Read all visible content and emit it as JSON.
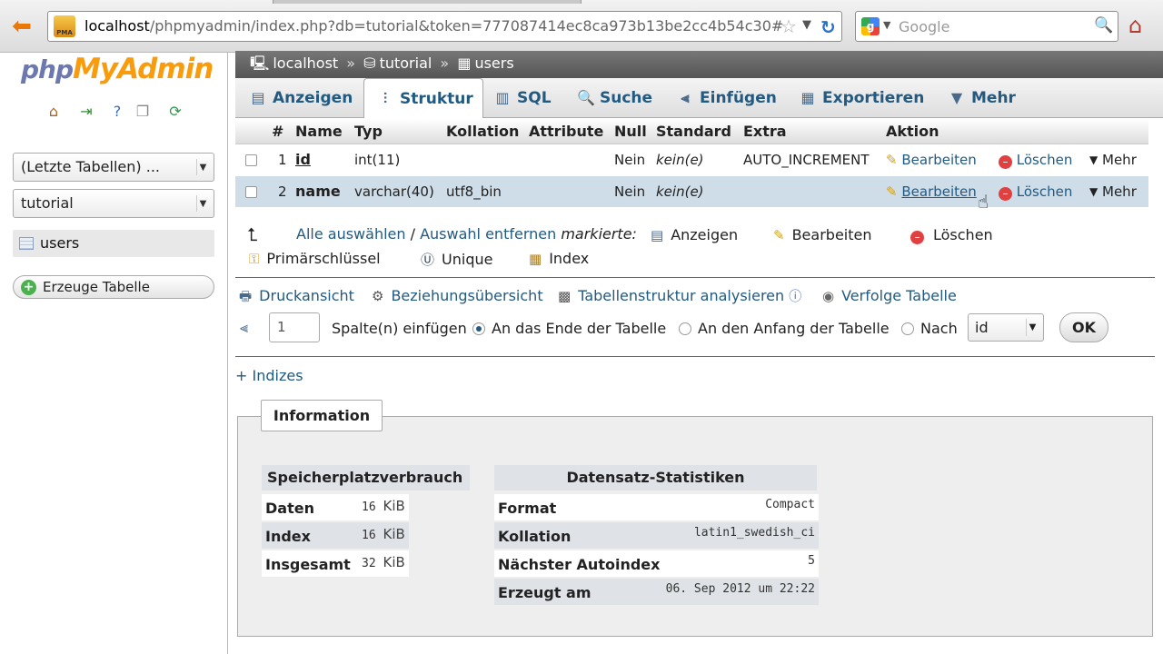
{
  "browser": {
    "url_host": "localhost",
    "url_rest": "/phpmyadmin/index.php?db=tutorial&token=777087414ec8ca973b13be2cc4b54c30#",
    "search_placeholder": "Google",
    "pma_icon_text": "PMA"
  },
  "sidebar": {
    "logo_php": "php",
    "logo_myadmin": "MyAdmin",
    "recent_tables": "(Letzte Tabellen) ...",
    "database": "tutorial",
    "table_item": "users",
    "create_table": "Erzeuge Tabelle"
  },
  "breadcrumb": {
    "server": "localhost",
    "sep1": "»",
    "database": "tutorial",
    "sep2": "»",
    "table": "users"
  },
  "tabs": [
    {
      "label": "Anzeigen",
      "icon": "browse-icon"
    },
    {
      "label": "Struktur",
      "icon": "structure-icon"
    },
    {
      "label": "SQL",
      "icon": "sql-icon"
    },
    {
      "label": "Suche",
      "icon": "search-icon"
    },
    {
      "label": "Einfügen",
      "icon": "insert-icon"
    },
    {
      "label": "Exportieren",
      "icon": "export-icon"
    },
    {
      "label": "Mehr",
      "icon": "chevron-down-icon"
    }
  ],
  "structure": {
    "headers": {
      "num": "#",
      "name": "Name",
      "type": "Typ",
      "collation": "Kollation",
      "attributes": "Attribute",
      "null": "Null",
      "default": "Standard",
      "extra": "Extra",
      "action": "Aktion"
    },
    "rows": [
      {
        "num": "1",
        "name": "id",
        "type": "int(11)",
        "collation": "",
        "null": "Nein",
        "default": "kein(e)",
        "extra": "AUTO_INCREMENT"
      },
      {
        "num": "2",
        "name": "name",
        "type": "varchar(40)",
        "collation": "utf8_bin",
        "null": "Nein",
        "default": "kein(e)",
        "extra": ""
      }
    ],
    "action_edit": "Bearbeiten",
    "action_delete": "Löschen",
    "action_more": "Mehr"
  },
  "bulk": {
    "select_all": "Alle auswählen",
    "slash": "/",
    "deselect": "Auswahl entfernen",
    "marked": "markierte:",
    "browse": "Anzeigen",
    "edit": "Bearbeiten",
    "delete": "Löschen",
    "primary": "Primärschlüssel",
    "unique": "Unique",
    "index": "Index"
  },
  "links": {
    "print": "Druckansicht",
    "relations": "Beziehungsübersicht",
    "analyze": "Tabellenstruktur analysieren",
    "track": "Verfolge Tabelle"
  },
  "addcol": {
    "count": "1",
    "label": "Spalte(n) einfügen",
    "opt_end": "An das Ende der Tabelle",
    "opt_begin": "An den Anfang der Tabelle",
    "opt_after": "Nach",
    "after_value": "id",
    "ok": "OK"
  },
  "indexes_toggle": "+ Indizes",
  "information": {
    "legend": "Information",
    "space": {
      "title": "Speicherplatzverbrauch",
      "rows": [
        {
          "label": "Daten",
          "value": "16",
          "unit": "KiB"
        },
        {
          "label": "Index",
          "value": "16",
          "unit": "KiB"
        },
        {
          "label": "Insgesamt",
          "value": "32",
          "unit": "KiB"
        }
      ]
    },
    "stats": {
      "title": "Datensatz-Statistiken",
      "rows": [
        {
          "label": "Format",
          "value": "Compact"
        },
        {
          "label": "Kollation",
          "value": "latin1_swedish_ci"
        },
        {
          "label": "Nächster Autoindex",
          "value": "5"
        },
        {
          "label": "Erzeugt am",
          "value": "06. Sep 2012 um 22:22"
        }
      ]
    }
  },
  "colors": {
    "link": "#235a81",
    "breadcrumb_bg": "#666666",
    "row_highlight": "#cfdde9",
    "logo_orange": "#f89c0e",
    "logo_blue": "#6c78af"
  }
}
